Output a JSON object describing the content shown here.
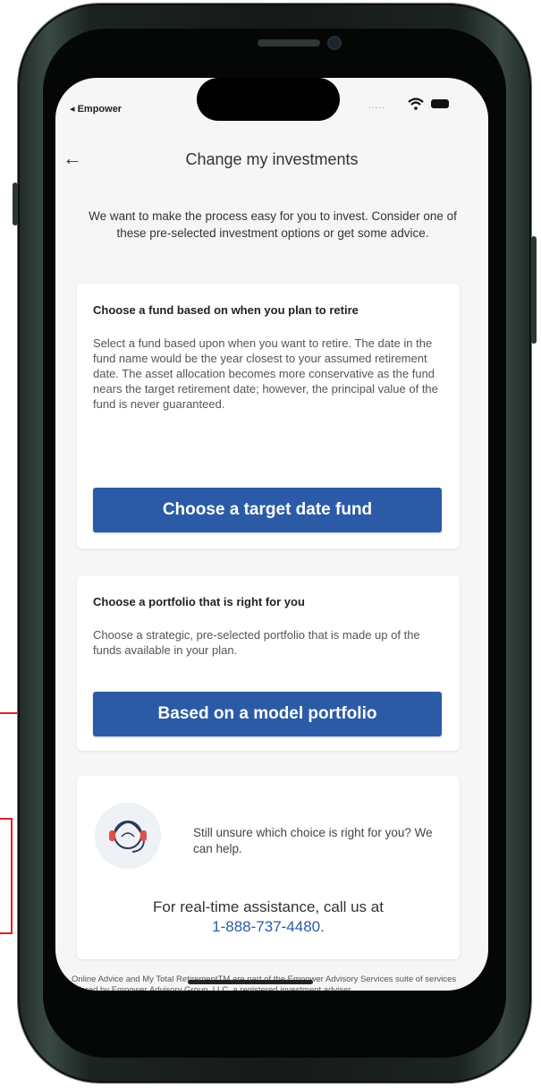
{
  "status_bar": {
    "back_app_label": "◂ Empower",
    "signal_dots": "....."
  },
  "nav": {
    "back_icon": "←",
    "title": "Change my investments"
  },
  "intro_text": "We want to make the process easy for you to invest. Consider one of these pre-selected investment options or get some advice.",
  "target_date_card": {
    "heading": "Choose a fund based on when you plan to retire",
    "description": "Select a fund based upon when you want to retire. The date in the fund name would be the year closest to your assumed retirement date. The asset allocation becomes more conservative as the fund nears the target retirement date; however, the principal value of the fund is never guaranteed.",
    "button_label": "Choose a target date fund"
  },
  "model_portfolio_card": {
    "heading": "Choose a portfolio that is right for you",
    "description": "Choose a strategic, pre-selected portfolio that is made up of the funds available in your plan.",
    "button_label": "Based on a model portfolio"
  },
  "help_card": {
    "icon": "support-agent-icon",
    "help_text": "Still unsure which choice is right for you? We can help.",
    "call_text": "For real-time assistance, call us at",
    "phone_number": "1-888-737-4480."
  },
  "footer": {
    "disclaimer": "Online Advice and My Total RetirementTM are part of the Empower Advisory Services suite of services offered by Empower Advisory Group, LLC, a registered investment adviser."
  },
  "colors": {
    "primary_button": "#2b5ba7",
    "annotation_red": "#e02020",
    "link_blue": "#2b5ba7"
  }
}
